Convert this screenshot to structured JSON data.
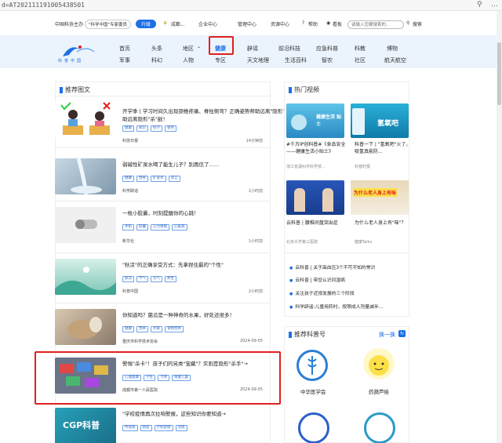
{
  "browser": {
    "url": "d=AT202111191005438501",
    "search_icon": "search-icon",
    "more_icon": "ellipsis-icon"
  },
  "util_bar": {
    "brand_label": "中国科协主办",
    "pill_label": "\"科学中国\"专家委员",
    "upgrade_label": "升级",
    "chengdu_label": "成都...",
    "links": [
      "企业中心",
      "管理中心",
      "资源中心"
    ],
    "help_label": "帮助",
    "favorite_label": "看板",
    "search_placeholder": "请输入您要搜索的...",
    "search_button": "搜索"
  },
  "nav": {
    "logo_text": "科普中国",
    "row1": [
      "首页",
      "头条",
      "地区",
      "健康",
      "辟谣",
      "前沿科技",
      "应急科普",
      "科教",
      "博物"
    ],
    "row2": [
      "军事",
      "科幻",
      "人物",
      "专区",
      "天文地理",
      "生活百科",
      "智农",
      "社区",
      "航天航空"
    ],
    "active": "健康"
  },
  "left": {
    "heading": "推荐图文",
    "articles": [
      {
        "title": "开学季 | 学习时间久出现颈椎疼痛、脊柱侧弯？正确姿势帮助远离\"隐形\"杀手",
        "title2": "助远离隐形\"杀\"敌！",
        "tags": [
          "健康",
          "知识",
          "科学",
          "姿势"
        ],
        "source": "科技日报",
        "time": "14分钟前"
      },
      {
        "title": "弱碱性矿泉水喝了能生儿子？别再信了……",
        "tags": [
          "健康",
          "营养",
          "矿泉水",
          "谣言"
        ],
        "source": "科学辟谣",
        "time": "1小时前"
      },
      {
        "title": "一枚小胶囊，时刻提醒你的心跳！",
        "tags": [
          "手机",
          "胶囊",
          "心力衰竭",
          "心脏病"
        ],
        "source": "新华社",
        "time": "1小时前"
      },
      {
        "title": "\"秋凉\"的正确享受方式：先拿捏住最的\"个性\"",
        "tags": [
          "秋凉",
          "节气",
          "天气",
          "养生"
        ],
        "source": "科普中国",
        "time": "2小时前"
      },
      {
        "title": "你知道吗？菌瓜是一种神奇的水果，好处还很多！",
        "tags": [
          "健康",
          "营养",
          "水果",
          "食物营养"
        ],
        "source": "重庆市科学技术协会",
        "time": "2024-09-05"
      },
      {
        "title": "警惕\"杀卡\"！孩子们的另类\"宝藏\"？实则是隐形\"杀手\"→",
        "tags": [
          "心理健康",
          "学生",
          "卡牌",
          "保健儿童"
        ],
        "source": "成都市第一人民医院",
        "time": "2024-09-05"
      },
      {
        "title": "\"学校疫情再次拉响警报，这些知识你要知道→",
        "tags": [
          "传染病",
          "防疫",
          "学校疫情",
          "流感"
        ],
        "source": "",
        "time": ""
      }
    ]
  },
  "right": {
    "video_heading": "热门视频",
    "videos": [
      {
        "title": "#千万IP创科普#《食品安全——健康生活小贴士》",
        "source": "浙江省湖州市科学技...",
        "overlay": "健康生活 贴士"
      },
      {
        "title": "科普一下 | \"氢氧吧\"火了，吸氢真能防...",
        "source": "科普时报",
        "overlay": "氢氧吧"
      },
      {
        "title": "云科普 | 腰椎间盘突出症",
        "source": "北京大学第三医院",
        "overlay": ""
      },
      {
        "title": "为什么老人身上有\"味\"？",
        "source": "健康Talks",
        "overlay": "为什么老人身上有味"
      }
    ],
    "list": [
      "云科普 | 关于高血压3个不可不知的常识",
      "云科普 | 带您认识风湿病",
      "关注孩子近视发展的三个阶段",
      "科学辟谣:儿童用药时，按照成人剂量减半..."
    ],
    "recommend_heading": "推荐科普号",
    "refresh_label": "换一换",
    "accounts": [
      "中华医学会",
      "药葫芦娃"
    ]
  },
  "colors": {
    "accent": "#1d6fe8",
    "nav_bg": "#ebf3fc",
    "highlight": "#e02020"
  }
}
